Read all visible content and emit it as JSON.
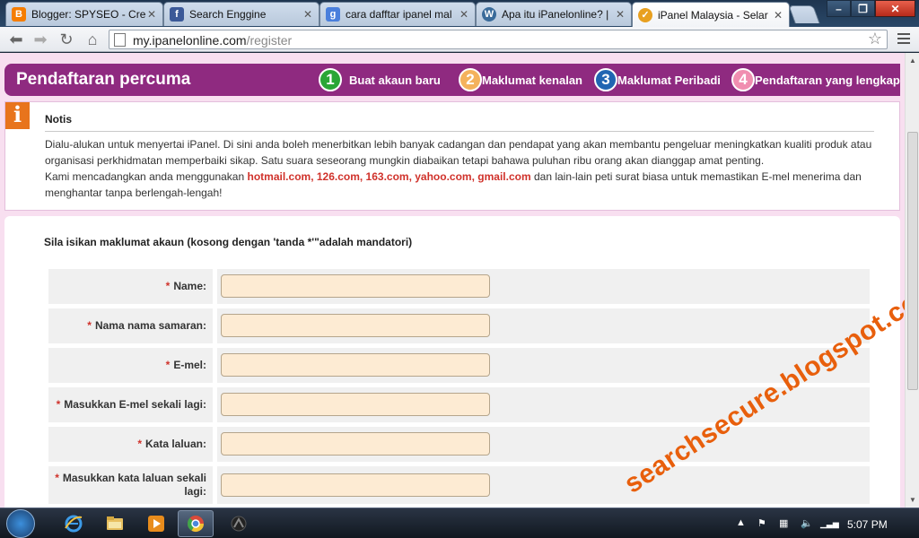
{
  "browser": {
    "tabs": [
      {
        "title": "Blogger: SPYSEO - Cre",
        "favicon": "blogger-icon"
      },
      {
        "title": "Search Enggine",
        "favicon": "facebook-icon"
      },
      {
        "title": "cara dafftar ipanel mal",
        "favicon": "google-icon"
      },
      {
        "title": "Apa itu iPanelonline? |",
        "favicon": "wordpress-icon"
      },
      {
        "title": "iPanel Malaysia - Selar",
        "favicon": "ipanel-icon"
      }
    ],
    "url_host": "my.ipanelonline.com",
    "url_path": "/register"
  },
  "header": {
    "title": "Pendaftaran percuma",
    "steps": [
      {
        "num": "1",
        "label": "Buat akaun baru",
        "color": "#2aa636"
      },
      {
        "num": "2",
        "label": "Maklumat kenalan",
        "color": "#f4b25c"
      },
      {
        "num": "3",
        "label": "Maklumat Peribadi",
        "color": "#2065b2"
      },
      {
        "num": "4",
        "label": "Pendaftaran yang lengkap",
        "color": "#f08eb0"
      }
    ]
  },
  "notice": {
    "title": "Notis",
    "para1": "Dialu-alukan untuk menyertai iPanel. Di sini anda boleh menerbitkan lebih banyak cadangan dan pendapat yang akan membantu pengeluar meningkatkan kualiti produk atau organisasi perkhidmatan memperbaiki sikap. Satu suara seseorang mungkin diabaikan tetapi bahawa puluhan ribu orang akan dianggap amat penting.",
    "para2_before": "Kami mencadangkan anda menggunakan",
    "email_providers": "hotmail.com, 126.com, 163.com, yahoo.com, gmail.com",
    "para2_after": "dan lain-lain peti surat biasa untuk memastikan E-mel menerima dan menghantar tanpa berlengah-lengah!"
  },
  "form": {
    "intro": "Sila isikan maklumat akaun (kosong dengan 'tanda *'\"adalah mandatori)",
    "required_mark": "*",
    "fields": [
      {
        "label": "Name:",
        "value": ""
      },
      {
        "label": "Nama nama samaran:",
        "value": ""
      },
      {
        "label": "E-mel:",
        "value": ""
      },
      {
        "label": "Masukkan E-mel sekali lagi:",
        "value": ""
      },
      {
        "label": "Kata laluan:",
        "value": ""
      },
      {
        "label": "Masukkan kata laluan sekali lagi:",
        "value": ""
      }
    ]
  },
  "watermark": "searchsecure.blogspot.com",
  "taskbar": {
    "clock": "5:07 PM"
  }
}
